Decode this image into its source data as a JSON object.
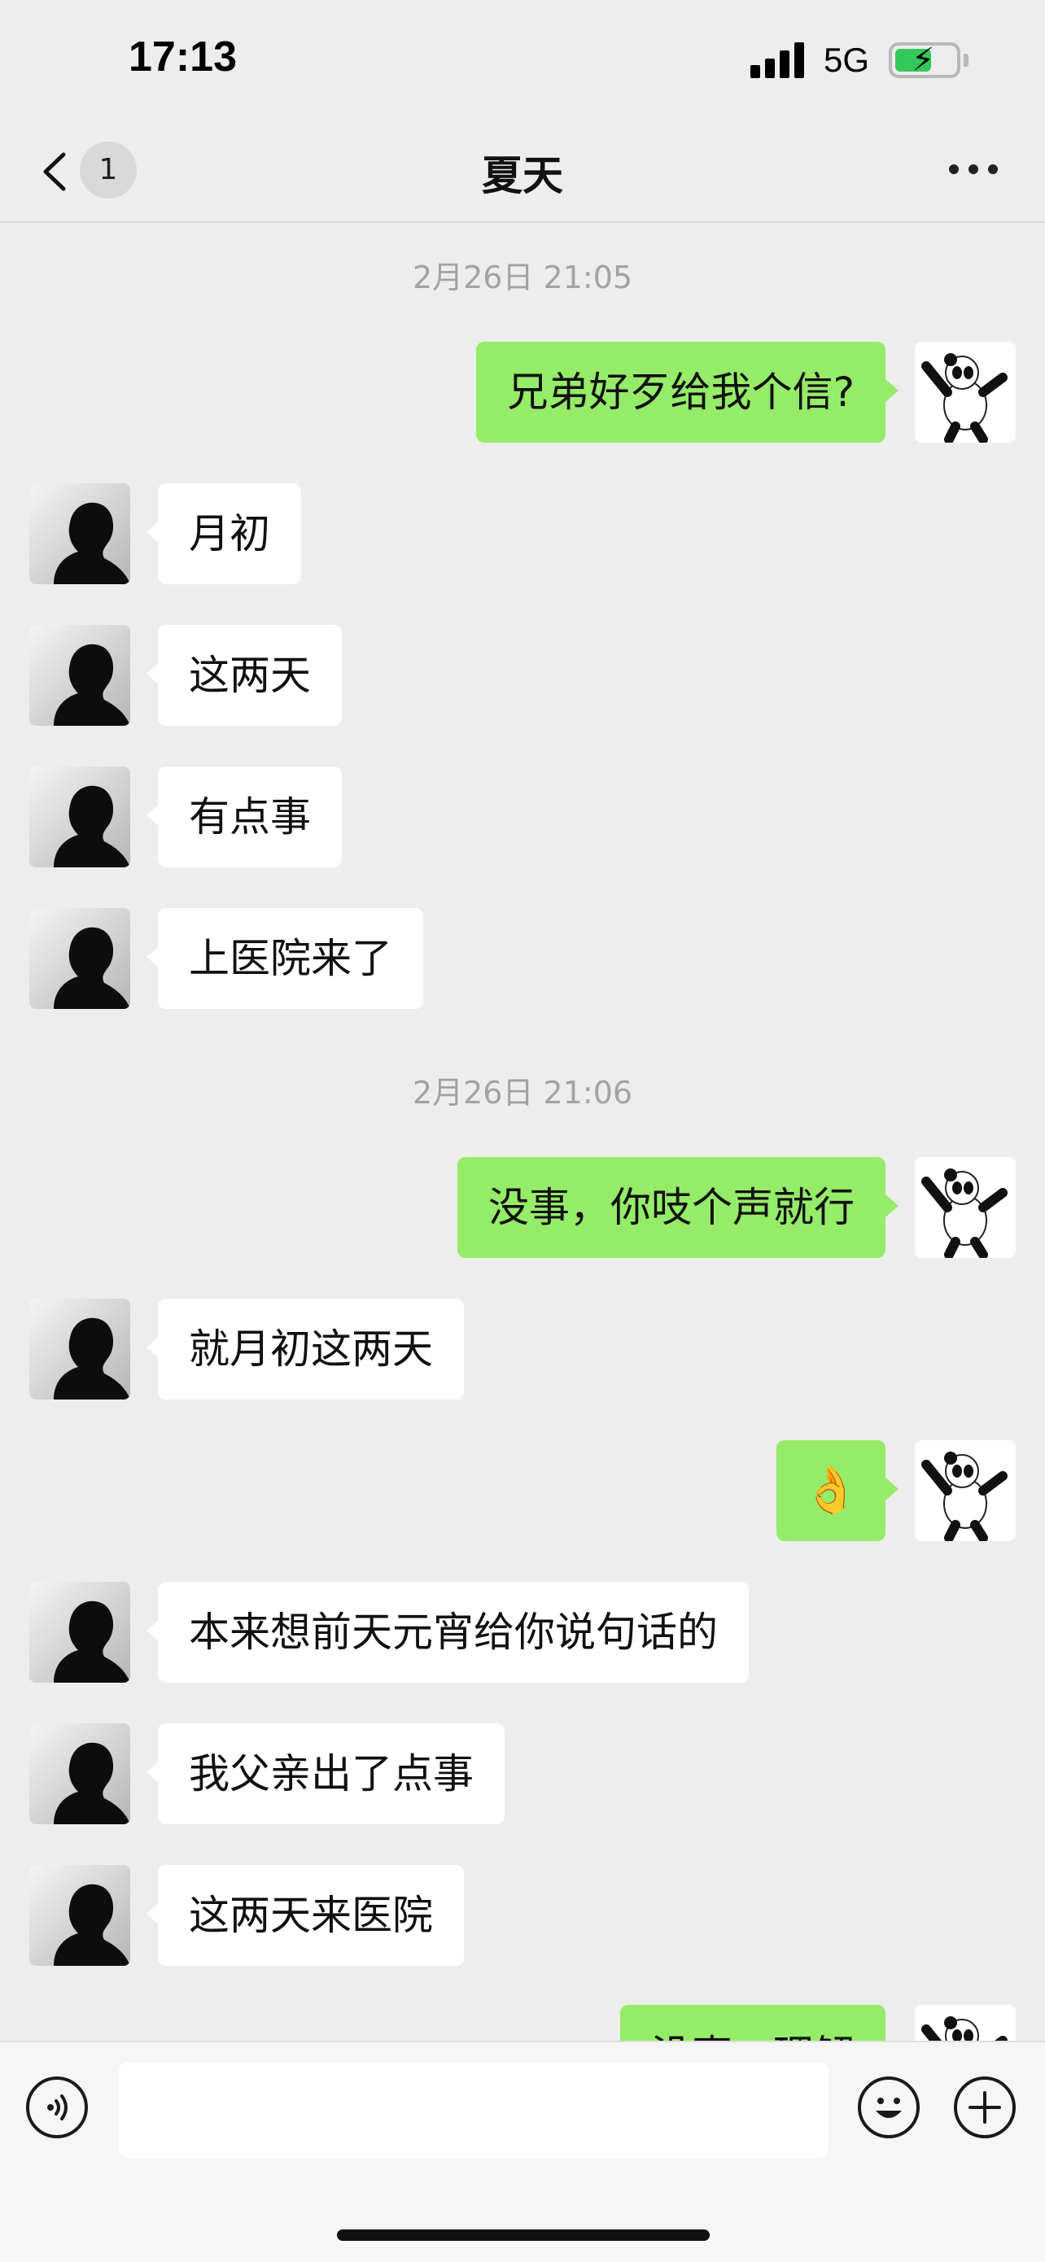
{
  "status_bar": {
    "time": "17:13",
    "network": "5G",
    "battery_charging": true
  },
  "nav": {
    "back_badge": "1",
    "title": "夏天"
  },
  "colors": {
    "background": "#ededed",
    "sent_bubble": "#95ec69",
    "received_bubble": "#ffffff"
  },
  "messages": [
    {
      "kind": "timestamp",
      "text": "2月26日 21:05"
    },
    {
      "kind": "sent",
      "text": "兄弟好歹给我个信?",
      "avatar": "panda-avatar"
    },
    {
      "kind": "received",
      "text": "月初",
      "avatar": "silhouette-avatar"
    },
    {
      "kind": "received",
      "text": "这两天",
      "avatar": "silhouette-avatar"
    },
    {
      "kind": "received",
      "text": "有点事",
      "avatar": "silhouette-avatar"
    },
    {
      "kind": "received",
      "text": "上医院来了",
      "avatar": "silhouette-avatar"
    },
    {
      "kind": "timestamp",
      "text": "2月26日 21:06"
    },
    {
      "kind": "sent",
      "text": "没事，你吱个声就行",
      "avatar": "panda-avatar"
    },
    {
      "kind": "received",
      "text": "就月初这两天",
      "avatar": "silhouette-avatar"
    },
    {
      "kind": "sent",
      "text": "👌",
      "avatar": "panda-avatar"
    },
    {
      "kind": "received",
      "text": "本来想前天元宵给你说句话的",
      "avatar": "silhouette-avatar"
    },
    {
      "kind": "received",
      "text": "我父亲出了点事",
      "avatar": "silhouette-avatar"
    },
    {
      "kind": "received",
      "text": "这两天来医院",
      "avatar": "silhouette-avatar"
    },
    {
      "kind": "sent",
      "text": "没事，理解",
      "avatar": "panda-avatar"
    }
  ],
  "input_bar": {
    "text_value": "",
    "icons": [
      "voice-icon",
      "emoji-icon",
      "plus-icon"
    ]
  }
}
